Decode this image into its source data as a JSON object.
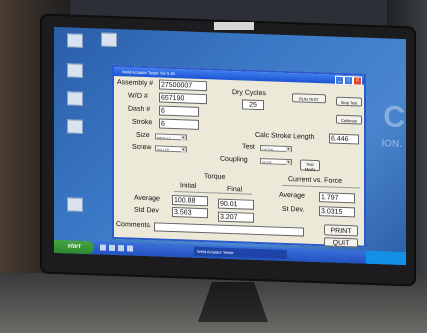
{
  "monitor": {
    "brand": ""
  },
  "desktop": {
    "icons": [
      {
        "label": ""
      },
      {
        "label": ""
      },
      {
        "label": ""
      },
      {
        "label": ""
      },
      {
        "label": ""
      },
      {
        "label": ""
      }
    ],
    "watermark": "C",
    "watermark_sub": "ION."
  },
  "taskbar": {
    "start_label": "start",
    "task_item": "Weld Actuator Tester"
  },
  "window": {
    "title": "Weld Actuator Tester Ver 5.45",
    "minimize": "_",
    "maximize": "□",
    "close": "X",
    "assembly": {
      "label": "Assembly #",
      "value": "27500007"
    },
    "wo": {
      "label": "W/O #",
      "value": "657190"
    },
    "dash": {
      "label": "Dash #",
      "value": "6"
    },
    "stroke": {
      "label": "Stroke",
      "value": "6"
    },
    "dry_cycles": {
      "label": "Dry Cycles",
      "value": "25"
    },
    "run_test_button": "RUN TEST",
    "stop_test_button": "Stop Test",
    "calibrate_button": "Calibrate",
    "size": {
      "label": "Size",
      "value": "Select a V"
    },
    "screw": {
      "label": "Screw",
      "value": "ROLLER"
    },
    "test": {
      "label": "Test",
      "value": "Full Test"
    },
    "coupling": {
      "label": "Coupling",
      "value": "INLINE"
    },
    "test_mods_button": "Test Mod's",
    "calc_stroke": {
      "label": "Calc Stroke Length",
      "value": "6.446"
    },
    "torque": {
      "header": "Torque",
      "initial_label": "Initial",
      "final_label": "Final",
      "average_label": "Average",
      "stddev_label": "Std Dev",
      "initial_average": "100.88",
      "initial_stddev": "3.563",
      "final_average": "90.01",
      "final_stddev": "3.207"
    },
    "current_force": {
      "header": "Current vs. Force",
      "average_label": "Average",
      "stddev_label": "St Dev.",
      "average": "1.797",
      "stddev": "3.0315"
    },
    "comments": {
      "label": "Comments",
      "value": ""
    },
    "print_button": "PRINT",
    "quit_button": "QUIT"
  }
}
